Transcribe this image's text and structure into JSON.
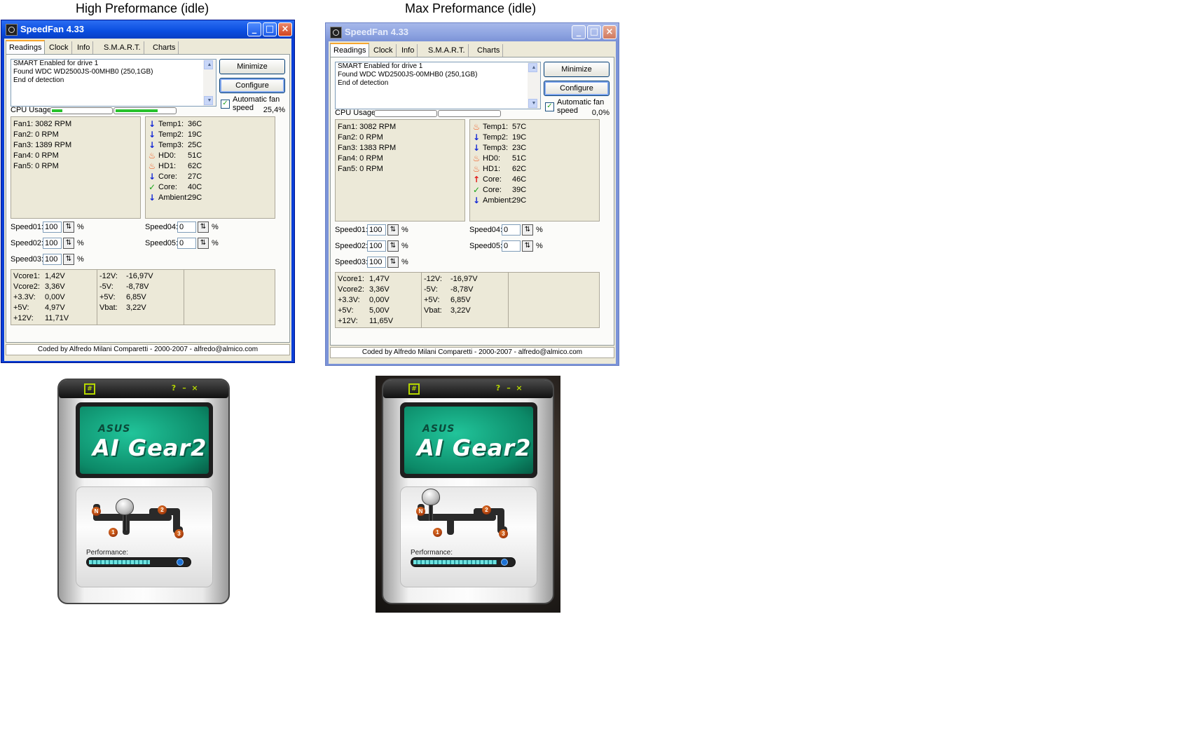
{
  "captions": {
    "left": "High Preformance (idle)",
    "right": "Max Preformance (idle)"
  },
  "app": {
    "title": "SpeedFan 4.33"
  },
  "tabs": [
    "Readings",
    "Clock",
    "Info",
    "S.M.A.R.T.",
    "Charts"
  ],
  "buttons": {
    "minimize": "Minimize",
    "configure": "Configure"
  },
  "auto_fan": {
    "line1": "Automatic fan",
    "line2": "speed",
    "checked": true
  },
  "cpu_label": "CPU Usage",
  "footer": "Coded by Alfredo Milani Comparetti - 2000-2007 - alfredo@almico.com",
  "speed_unit": "%",
  "windows": [
    {
      "log": [
        "SMART Enabled for drive 1",
        "Found WDC WD2500JS-00MHB0 (250,1GB)",
        "End of detection"
      ],
      "cpu_percent": "25,4%",
      "cpu_bars": [
        0.18,
        0.72
      ],
      "fans": [
        "Fan1: 3082 RPM",
        "Fan2: 0 RPM",
        "Fan3: 1389 RPM",
        "Fan4: 0 RPM",
        "Fan5: 0 RPM"
      ],
      "temps": [
        {
          "icon": "arrow-down-icon",
          "label": "Temp1:",
          "value": "36C"
        },
        {
          "icon": "arrow-down-icon",
          "label": "Temp2:",
          "value": "19C"
        },
        {
          "icon": "arrow-down-icon",
          "label": "Temp3:",
          "value": "25C"
        },
        {
          "icon": "flame-icon",
          "label": "HD0:",
          "value": "51C"
        },
        {
          "icon": "flame-icon",
          "label": "HD1:",
          "value": "62C"
        },
        {
          "icon": "arrow-down-icon",
          "label": "Core:",
          "value": "27C"
        },
        {
          "icon": "checkmark-icon",
          "label": "Core:",
          "value": "40C"
        },
        {
          "icon": "arrow-down-icon",
          "label": "Ambient:",
          "value": "29C"
        }
      ],
      "speeds_left": [
        {
          "label": "Speed01:",
          "value": "100"
        },
        {
          "label": "Speed02:",
          "value": "100"
        },
        {
          "label": "Speed03:",
          "value": "100"
        }
      ],
      "speeds_right": [
        {
          "label": "Speed04:",
          "value": "0"
        },
        {
          "label": "Speed05:",
          "value": "0"
        }
      ],
      "volts_left": [
        {
          "label": "Vcore1:",
          "value": "1,42V"
        },
        {
          "label": "Vcore2:",
          "value": "3,36V"
        },
        {
          "label": "+3.3V:",
          "value": "0,00V"
        },
        {
          "label": "+5V:",
          "value": "4,97V"
        },
        {
          "label": "+12V:",
          "value": "11,71V"
        }
      ],
      "volts_right": [
        {
          "label": "-12V:",
          "value": "-16,97V"
        },
        {
          "label": "-5V:",
          "value": "-8,78V"
        },
        {
          "label": "+5V:",
          "value": "6,85V"
        },
        {
          "label": "Vbat:",
          "value": "3,22V"
        }
      ]
    },
    {
      "log": [
        "SMART Enabled for drive 1",
        "Found WDC WD2500JS-00MHB0 (250,1GB)",
        "End of detection"
      ],
      "cpu_percent": "0,0%",
      "cpu_bars": [
        0,
        0
      ],
      "fans": [
        "Fan1: 3082 RPM",
        "Fan2: 0 RPM",
        "Fan3: 1383 RPM",
        "Fan4: 0 RPM",
        "Fan5: 0 RPM"
      ],
      "temps": [
        {
          "icon": "flame-icon",
          "label": "Temp1:",
          "value": "57C"
        },
        {
          "icon": "arrow-down-icon",
          "label": "Temp2:",
          "value": "19C"
        },
        {
          "icon": "arrow-down-icon",
          "label": "Temp3:",
          "value": "23C"
        },
        {
          "icon": "flame-icon",
          "label": "HD0:",
          "value": "51C"
        },
        {
          "icon": "flame-icon",
          "label": "HD1:",
          "value": "62C"
        },
        {
          "icon": "arrow-up-icon",
          "label": "Core:",
          "value": "46C"
        },
        {
          "icon": "checkmark-icon",
          "label": "Core:",
          "value": "39C"
        },
        {
          "icon": "arrow-down-icon",
          "label": "Ambient:",
          "value": "29C"
        }
      ],
      "speeds_left": [
        {
          "label": "Speed01:",
          "value": "100"
        },
        {
          "label": "Speed02:",
          "value": "100"
        },
        {
          "label": "Speed03:",
          "value": "100"
        }
      ],
      "speeds_right": [
        {
          "label": "Speed04:",
          "value": "0"
        },
        {
          "label": "Speed05:",
          "value": "0"
        }
      ],
      "volts_left": [
        {
          "label": "Vcore1:",
          "value": "1,47V"
        },
        {
          "label": "Vcore2:",
          "value": "3,36V"
        },
        {
          "label": "+3.3V:",
          "value": "0,00V"
        },
        {
          "label": "+5V:",
          "value": "5,00V"
        },
        {
          "label": "+12V:",
          "value": "11,65V"
        }
      ],
      "volts_right": [
        {
          "label": "-12V:",
          "value": "-16,97V"
        },
        {
          "label": "-5V:",
          "value": "-8,78V"
        },
        {
          "label": "+5V:",
          "value": "6,85V"
        },
        {
          "label": "Vbat:",
          "value": "3,22V"
        }
      ]
    }
  ],
  "aigear": {
    "brand": "ASUS",
    "name": "AI Gear2",
    "controls": [
      "?",
      "–",
      "×"
    ],
    "gears": [
      "N",
      "1",
      "2",
      "3"
    ],
    "performance_label": "Performance:",
    "widgets": [
      {
        "selected_gear": "N",
        "performance": 0.62
      },
      {
        "selected_gear": "N",
        "performance": 0.85
      }
    ]
  }
}
